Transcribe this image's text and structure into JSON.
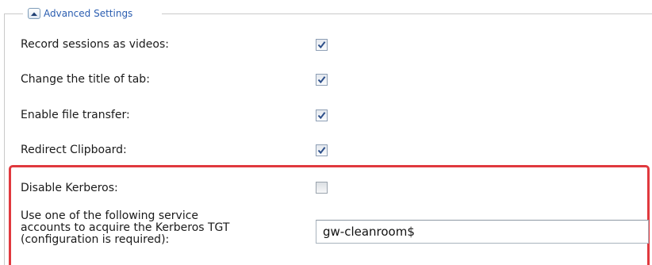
{
  "section": {
    "title": "Advanced Settings",
    "collapse_icon": "chevron-up-icon",
    "accent_color": "#2a5db0"
  },
  "settings": {
    "record_sessions": {
      "label": "Record sessions as videos:",
      "checked": true
    },
    "change_title": {
      "label": "Change the title of tab:",
      "checked": true
    },
    "file_transfer": {
      "label": "Enable file transfer:",
      "checked": true
    },
    "redirect_clipboard": {
      "label": "Redirect Clipboard:",
      "checked": true
    },
    "disable_kerberos": {
      "label": "Disable Kerberos:",
      "checked": false
    },
    "service_accounts": {
      "label_lines": [
        "Use one of the following service",
        "accounts to acquire the Kerberos TGT",
        "(configuration is required):"
      ],
      "value": "gw-cleanroom$"
    }
  },
  "highlight_color": "#e0393e",
  "check_icon": "checkmark-icon"
}
